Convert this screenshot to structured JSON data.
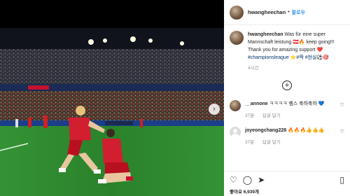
{
  "photo": {
    "alt_icon": "photo-of-two-football-players-celebrating"
  },
  "post": {
    "username": "hwangheechan",
    "follow_separator": "•",
    "follow_label": "팔로우",
    "caption_user": "hwangheechan",
    "caption_text_1": "Was für eine super Mannschaft leistung",
    "caption_emoji_1": "🇦🇹🔥",
    "caption_text_2": "keep going!!!",
    "caption_text_3": "Thank you for amazing support",
    "caption_emoji_3": "❤️",
    "caption_tag": "#championsleague",
    "caption_tail": "⭐#짝 #현실⚽🎯",
    "caption_time": "4시간",
    "load_more": "+",
    "comments": [
      {
        "user": "__annone",
        "text": "ㅋㅋㅋㅋ 헴스 축하축하 💙",
        "time": "37분",
        "reply": "답글 달기"
      },
      {
        "user": "joyeongchang228",
        "text": "🔥🔥🔥👍👍👍",
        "time": "37분",
        "reply": "답글 달기"
      }
    ],
    "likes_text": "좋아요 6,939개"
  },
  "colors": {
    "accent": "#3897f0",
    "hashtag": "#003569",
    "muted": "#8e8e8e"
  },
  "icons": [
    "heart-icon",
    "comment-icon",
    "share-icon",
    "bookmark-icon",
    "plus-circle-icon",
    "chevron-right-icon"
  ]
}
